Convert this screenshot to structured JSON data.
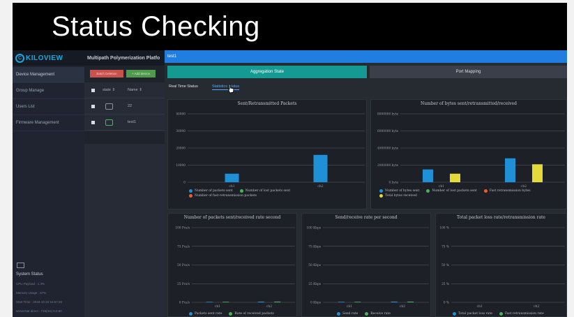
{
  "slide_title": "Status Checking",
  "colors": {
    "accent_blue": "#1f7ee0",
    "teal": "#159a93",
    "bar_blue": "#1f8fd6",
    "bar_green": "#49b35a",
    "bar_orange": "#f05b2a",
    "bar_yellow": "#e3d93a"
  },
  "sidebar": {
    "logo_text": "KILOVIEW",
    "logo_mark": "C",
    "items": [
      {
        "label": "Device Management"
      },
      {
        "label": "Group Manage"
      },
      {
        "label": "Users List"
      },
      {
        "label": "Firmware Management"
      }
    ],
    "system_status": {
      "title": "System Status",
      "lines": [
        "CPU Payload : 1.4%",
        "Memory Usage : 67%",
        "Start Time : 2019-10-22 16:57:26",
        "serverNat direct : 715(ms) 0.0.80"
      ]
    }
  },
  "platform_title": "Multipath Polymerization Platfo",
  "toolbar": {
    "delete_label": "Batch Deletion",
    "add_label": "+ Add device"
  },
  "table": {
    "header": {
      "state": "state ⇕",
      "name": "Name ⇕"
    },
    "rows": [
      {
        "name": "22"
      },
      {
        "name": "test1"
      }
    ]
  },
  "main": {
    "header_title": "test1",
    "btn_aggregation": "Aggregation State",
    "btn_port": "Port Mapping",
    "tab_realtime": "Real Time Status",
    "tab_statistics": "Statistics Status"
  },
  "chart_data": [
    {
      "type": "bar",
      "title": "Sent/Retransmitted Packets",
      "categories": [
        "ch1",
        "ch2"
      ],
      "ylim": [
        0,
        40000
      ],
      "yticks": [
        "0",
        "10000",
        "20000",
        "30000",
        "40000"
      ],
      "series": [
        {
          "name": "Number of packets sent",
          "color": "#1f8fd6",
          "values": [
            5000,
            16000
          ]
        },
        {
          "name": "Number of lost packets sent",
          "color": "#49b35a",
          "values": [
            0,
            0
          ]
        },
        {
          "name": "Number of fast retransmission packets",
          "color": "#f05b2a",
          "values": [
            0,
            0
          ]
        }
      ]
    },
    {
      "type": "bar",
      "title": "Number of bytes sent/retransmitted/received",
      "categories": [
        "ch1",
        "ch2"
      ],
      "ylim": [
        0,
        8000000
      ],
      "yticks": [
        "0 byte",
        "2000000 byte",
        "4000000 byte",
        "6000000 byte",
        "8000000 byte"
      ],
      "series": [
        {
          "name": "Number of bytes sent",
          "color": "#1f8fd6",
          "values": [
            1500000,
            2800000
          ]
        },
        {
          "name": "Number of lost packets sent",
          "color": "#49b35a",
          "values": [
            0,
            0
          ]
        },
        {
          "name": "Fast retransmission bytes",
          "color": "#f05b2a",
          "values": [
            0,
            0
          ]
        },
        {
          "name": "Total bytes received",
          "color": "#e3d93a",
          "values": [
            1000000,
            2100000
          ]
        }
      ]
    },
    {
      "type": "bar",
      "title": "Number of packets sent/received rate second",
      "categories": [
        "ch1",
        "ch2"
      ],
      "ylim": [
        0,
        100
      ],
      "yticks": [
        "0 Pcs/s",
        "25 Pcs/s",
        "50 Pcs/s",
        "75 Pcs/s",
        "100 Pcs/s"
      ],
      "series": [
        {
          "name": "Packets sent rate",
          "color": "#1f8fd6",
          "values": [
            0.5,
            1
          ]
        },
        {
          "name": "Rate of received packets",
          "color": "#49b35a",
          "values": [
            0.5,
            1
          ]
        }
      ]
    },
    {
      "type": "bar",
      "title": "Send/receive rate per second",
      "categories": [
        "ch1",
        "ch2"
      ],
      "ylim": [
        0,
        100
      ],
      "yticks": [
        "0 Kbps",
        "25 Kbps",
        "50 Kbps",
        "75 Kbps",
        "100 Kbps"
      ],
      "series": [
        {
          "name": "Send rate",
          "color": "#1f8fd6",
          "values": [
            0.5,
            1
          ]
        },
        {
          "name": "Receive rate",
          "color": "#49b35a",
          "values": [
            0.5,
            1
          ]
        }
      ]
    },
    {
      "type": "bar",
      "title": "Total packet loss rate/retransmission rate",
      "categories": [
        "ch1",
        "ch2"
      ],
      "ylim": [
        0,
        100
      ],
      "yticks": [
        "0 %",
        "25 %",
        "50 %",
        "75 %",
        "100 %"
      ],
      "series": [
        {
          "name": "Total packet loss rate",
          "color": "#1f8fd6",
          "values": [
            0,
            0
          ]
        },
        {
          "name": "Fast retransmission rate",
          "color": "#49b35a",
          "values": [
            0,
            0
          ]
        }
      ]
    }
  ]
}
